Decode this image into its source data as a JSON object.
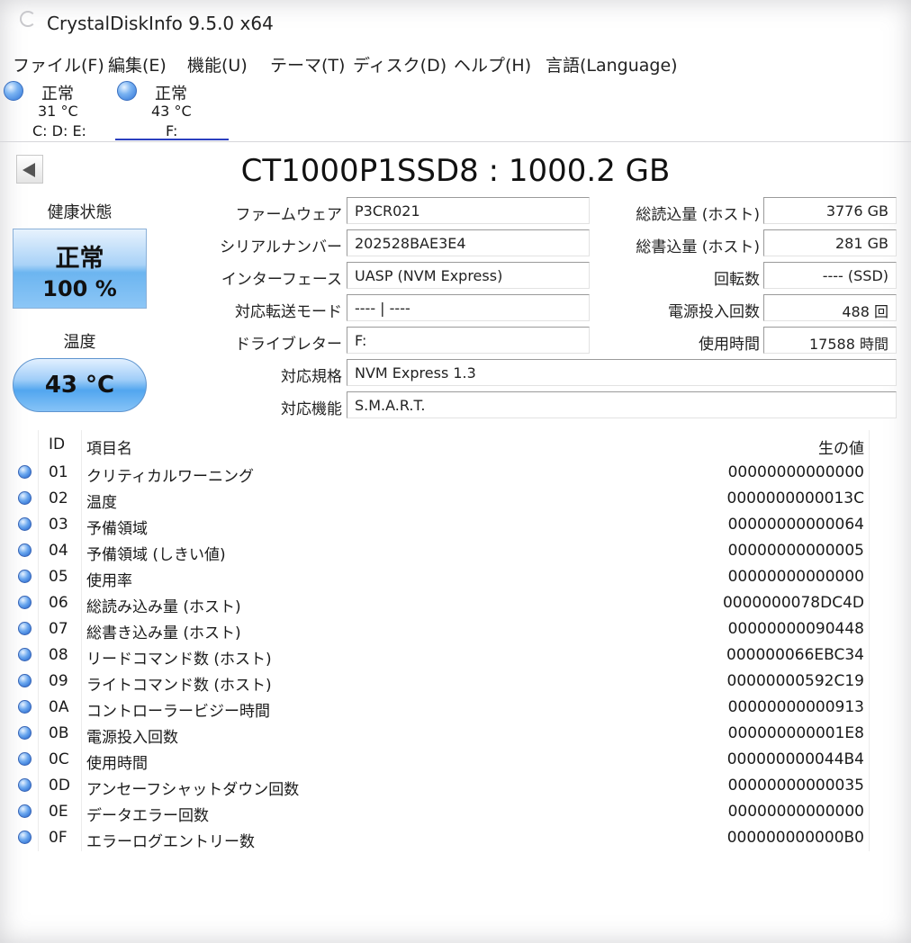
{
  "window": {
    "title": "CrystalDiskInfo 9.5.0 x64"
  },
  "menu": [
    {
      "label": "ファイル(F)"
    },
    {
      "label": "編集(E)"
    },
    {
      "label": "機能(U)"
    },
    {
      "label": "テーマ(T)"
    },
    {
      "label": "ディスク(D)"
    },
    {
      "label": "ヘルプ(H)"
    },
    {
      "label": "言語(Language)"
    }
  ],
  "drives": [
    {
      "status": "正常",
      "temp": "31 °C",
      "letters": "C: D: E:",
      "selected": false
    },
    {
      "status": "正常",
      "temp": "43 °C",
      "letters": "F:",
      "selected": true
    }
  ],
  "disk": {
    "model": "CT1000P1SSD8 : 1000.2 GB",
    "health_label": "健康状態",
    "health_status": "正常",
    "health_percent": "100 %",
    "temp_label": "温度",
    "temperature": "43 °C"
  },
  "info_left": [
    {
      "label": "ファームウェア",
      "value": "P3CR021"
    },
    {
      "label": "シリアルナンバー",
      "value": "202528BAE3E4"
    },
    {
      "label": "インターフェース",
      "value": "UASP (NVM Express)"
    },
    {
      "label": "対応転送モード",
      "value": "---- | ----"
    },
    {
      "label": "ドライブレター",
      "value": "F:"
    }
  ],
  "info_right": [
    {
      "label": "総読込量 (ホスト)",
      "value": "3776 GB"
    },
    {
      "label": "総書込量 (ホスト)",
      "value": "281 GB"
    },
    {
      "label": "回転数",
      "value": "---- (SSD)"
    },
    {
      "label": "電源投入回数",
      "value": "488 回"
    },
    {
      "label": "使用時間",
      "value": "17588 時間"
    }
  ],
  "info_wide": [
    {
      "label": "対応規格",
      "value": "NVM Express 1.3"
    },
    {
      "label": "対応機能",
      "value": "S.M.A.R.T."
    }
  ],
  "smart": {
    "headers": {
      "id": "ID",
      "name": "項目名",
      "raw": "生の値"
    },
    "rows": [
      {
        "id": "01",
        "name": "クリティカルワーニング",
        "raw": "00000000000000"
      },
      {
        "id": "02",
        "name": "温度",
        "raw": "0000000000013C"
      },
      {
        "id": "03",
        "name": "予備領域",
        "raw": "00000000000064"
      },
      {
        "id": "04",
        "name": "予備領域 (しきい値)",
        "raw": "00000000000005"
      },
      {
        "id": "05",
        "name": "使用率",
        "raw": "00000000000000"
      },
      {
        "id": "06",
        "name": "総読み込み量 (ホスト)",
        "raw": "0000000078DC4D"
      },
      {
        "id": "07",
        "name": "総書き込み量 (ホスト)",
        "raw": "00000000090448"
      },
      {
        "id": "08",
        "name": "リードコマンド数 (ホスト)",
        "raw": "000000066EBC34"
      },
      {
        "id": "09",
        "name": "ライトコマンド数 (ホスト)",
        "raw": "00000000592C19"
      },
      {
        "id": "0A",
        "name": "コントローラービジー時間",
        "raw": "00000000000913"
      },
      {
        "id": "0B",
        "name": "電源投入回数",
        "raw": "000000000001E8"
      },
      {
        "id": "0C",
        "name": "使用時間",
        "raw": "000000000044B4"
      },
      {
        "id": "0D",
        "name": "アンセーフシャットダウン回数",
        "raw": "00000000000035"
      },
      {
        "id": "0E",
        "name": "データエラー回数",
        "raw": "00000000000000"
      },
      {
        "id": "0F",
        "name": "エラーログエントリー数",
        "raw": "000000000000B0"
      }
    ]
  }
}
